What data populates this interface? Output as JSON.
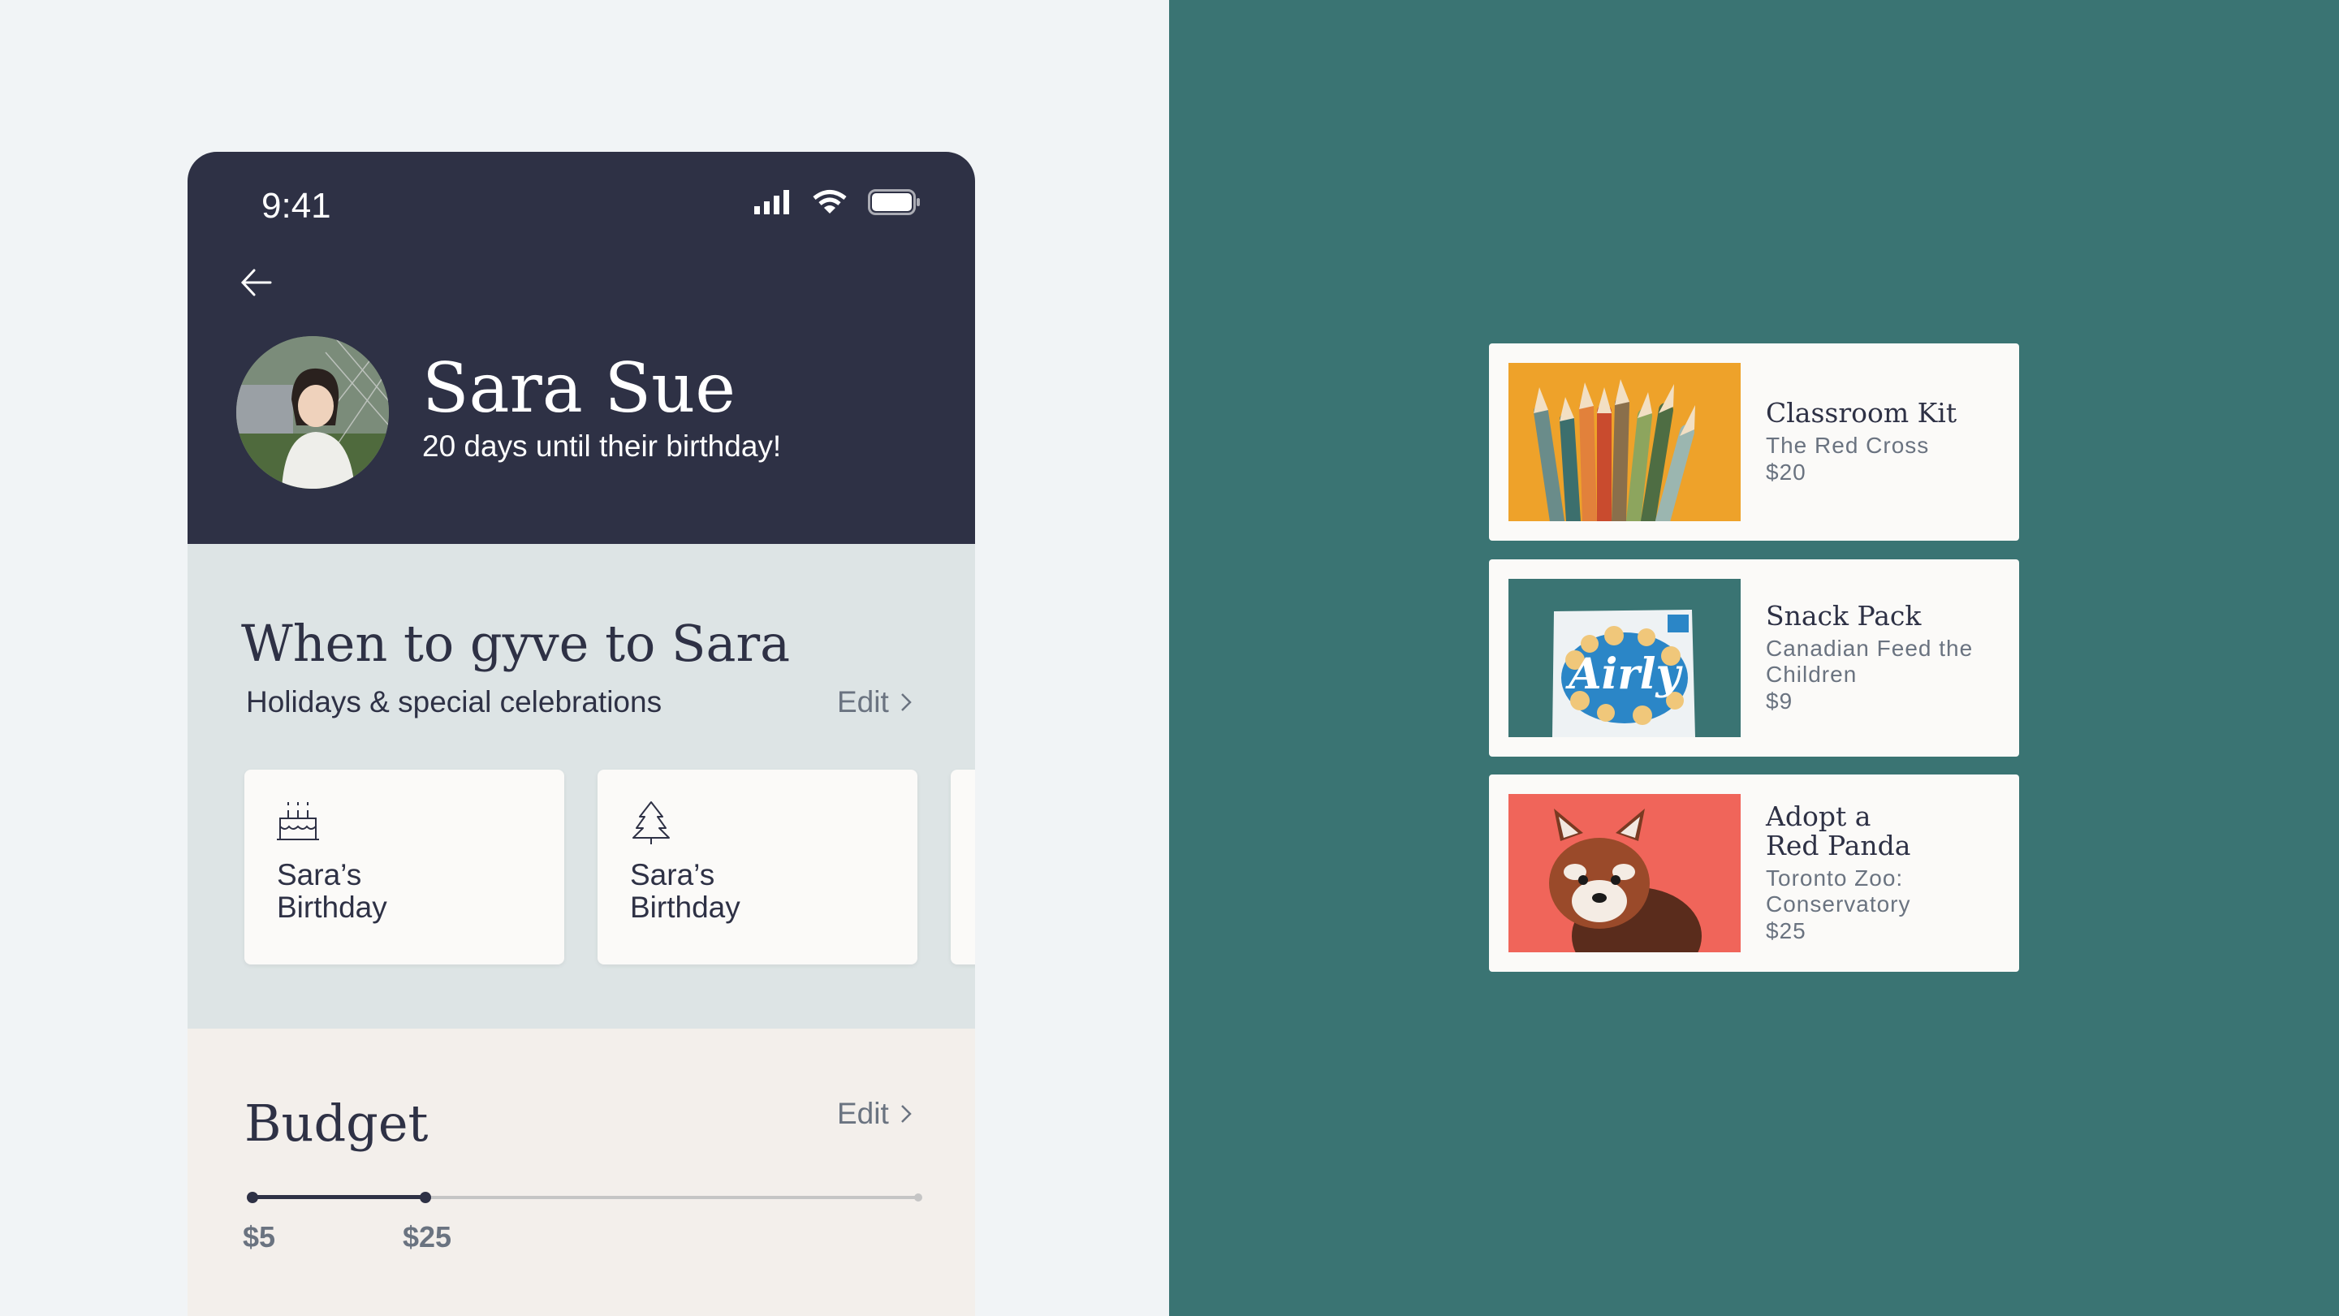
{
  "status_bar": {
    "time": "9:41"
  },
  "profile": {
    "name": "Sara Sue",
    "subtitle": "20 days until their birthday!"
  },
  "when_section": {
    "title": "When to gyve to Sara",
    "subtitle": "Holidays & special celebrations",
    "edit_label": "Edit",
    "cards": [
      {
        "icon": "birthday-cake-icon",
        "label": "Sara’s Birthday"
      },
      {
        "icon": "tree-icon",
        "label": "Sara’s Birthday"
      }
    ]
  },
  "budget": {
    "title": "Budget",
    "edit_label": "Edit",
    "min_label": "$5",
    "max_label": "$25",
    "min_value": 5,
    "selected_value": 25,
    "range_fraction": 0.26
  },
  "gifts": [
    {
      "title": "Classroom Kit",
      "org": "The Red Cross",
      "price": "$20",
      "image": "colored-pencils"
    },
    {
      "title": "Snack Pack",
      "org": "Canadian Feed the Children",
      "price": "$9",
      "image": "snack-box"
    },
    {
      "title": "Adopt a Red Panda",
      "org": "Toronto Zoo: Conservatory",
      "price": "$25",
      "image": "red-panda"
    }
  ],
  "colors": {
    "header": "#2e3145",
    "right_background": "#3a7473",
    "section_blue": "#dde4e5",
    "section_beige": "#f3efeb"
  }
}
